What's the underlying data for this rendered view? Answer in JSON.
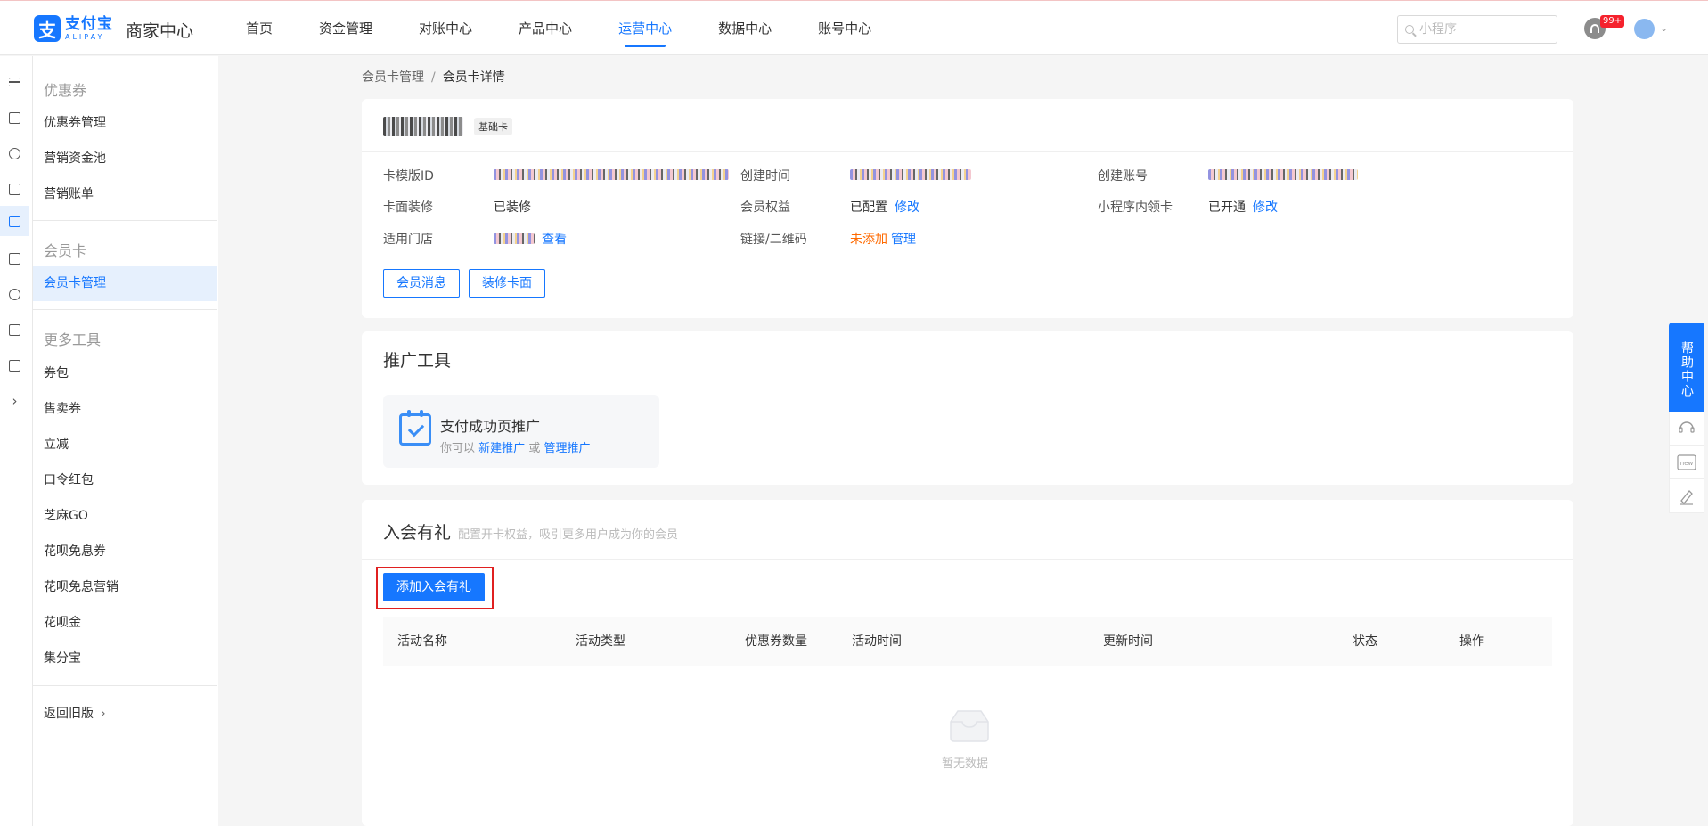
{
  "header": {
    "logo_cn": "支付宝",
    "logo_en": "ALIPAY",
    "logo_glyph": "支",
    "app_title": "商家中心",
    "nav": [
      {
        "label": "首页",
        "active": false
      },
      {
        "label": "资金管理",
        "active": false
      },
      {
        "label": "对账中心",
        "active": false
      },
      {
        "label": "产品中心",
        "active": false
      },
      {
        "label": "运营中心",
        "active": true
      },
      {
        "label": "数据中心",
        "active": false
      },
      {
        "label": "账号中心",
        "active": false
      }
    ],
    "search_placeholder": "小程序",
    "notification_badge": "99+",
    "accent_color": "#1677ff"
  },
  "rail": {
    "icons": [
      "menu-icon",
      "coupon-icon",
      "product-icon",
      "document-icon",
      "gift-icon",
      "list-icon",
      "target-icon",
      "wallet-icon",
      "report-icon",
      "expand-icon"
    ],
    "active_index": 4
  },
  "sidebar": {
    "groups": [
      {
        "title": "优惠券",
        "items": [
          "优惠券管理",
          "营销资金池",
          "营销账单"
        ]
      },
      {
        "title": "会员卡",
        "items": [
          "会员卡管理"
        ]
      },
      {
        "title": "更多工具",
        "items": [
          "券包",
          "售卖券",
          "立减",
          "口令红包",
          "芝麻GO",
          "花呗免息券",
          "花呗免息营销",
          "花呗金",
          "集分宝"
        ]
      }
    ],
    "active_item": "会员卡管理",
    "back_label": "返回旧版"
  },
  "breadcrumb": {
    "parent": "会员卡管理",
    "separator": "/",
    "current": "会员卡详情"
  },
  "card_detail": {
    "tag": "基础卡",
    "fields": {
      "template_id_label": "卡模版ID",
      "created_time_label": "创建时间",
      "created_account_label": "创建账号",
      "face_label": "卡面装修",
      "face_value": "已装修",
      "rights_label": "会员权益",
      "rights_value": "已配置",
      "rights_link": "修改",
      "miniapp_label": "小程序内领卡",
      "miniapp_value": "已开通",
      "miniapp_link": "修改",
      "stores_label": "适用门店",
      "stores_link": "查看",
      "qrcode_label": "链接/二维码",
      "qrcode_value": "未添加",
      "qrcode_link": "管理"
    },
    "buttons": {
      "message": "会员消息",
      "decorate": "装修卡面"
    }
  },
  "promotion": {
    "title": "推广工具",
    "tile_title": "支付成功页推广",
    "tile_prefix": "你可以",
    "tile_link1": "新建推广",
    "tile_or": "或",
    "tile_link2": "管理推广"
  },
  "welcome_gift": {
    "title": "入会有礼",
    "subtitle": "配置开卡权益，吸引更多用户成为你的会员",
    "add_button": "添加入会有礼",
    "columns": [
      "活动名称",
      "活动类型",
      "优惠券数量",
      "活动时间",
      "更新时间",
      "状态",
      "操作"
    ],
    "empty_text": "暂无数据"
  },
  "help": {
    "label": "帮助中心"
  }
}
